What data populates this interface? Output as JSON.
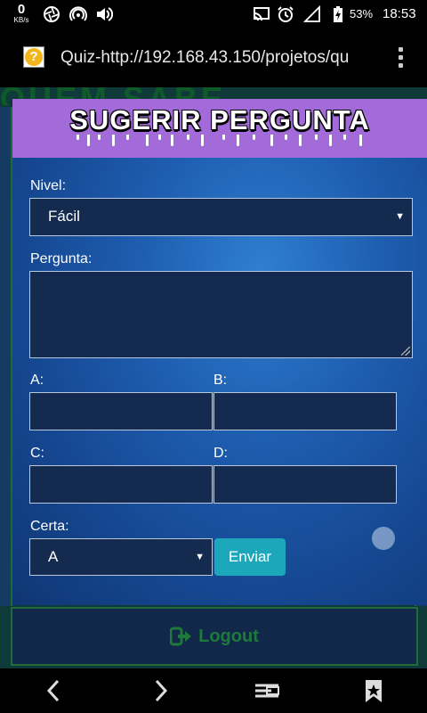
{
  "status_bar": {
    "net_speed_value": "0",
    "net_speed_unit": "KB/s",
    "battery_percent": "53%",
    "time": "18:53"
  },
  "browser": {
    "url": "Quiz-http://192.168.43.150/projetos/qu"
  },
  "background": {
    "banner_text": "QUEM SABE",
    "logout_label": "Logout"
  },
  "form": {
    "title": "SUGERIR PERGUNTA",
    "level": {
      "label": "Nivel:",
      "value": "Fácil"
    },
    "question": {
      "label": "Pergunta:",
      "value": ""
    },
    "option_a": {
      "label": "A:",
      "value": ""
    },
    "option_b": {
      "label": "B:",
      "value": ""
    },
    "option_c": {
      "label": "C:",
      "value": ""
    },
    "option_d": {
      "label": "D:",
      "value": ""
    },
    "correct": {
      "label": "Certa:",
      "value": "A"
    },
    "submit_label": "Enviar"
  },
  "colors": {
    "header_purple": "#a36bda",
    "button_teal": "#1da7ba",
    "field_bg": "#142a4f",
    "logout_green": "#1d7a3a"
  },
  "icons": [
    "cast-icon",
    "alarm-icon",
    "no-signal-icon",
    "battery-charging-icon",
    "back-icon",
    "forward-icon",
    "tabs-icon",
    "bookmark-icon",
    "logout-icon"
  ]
}
